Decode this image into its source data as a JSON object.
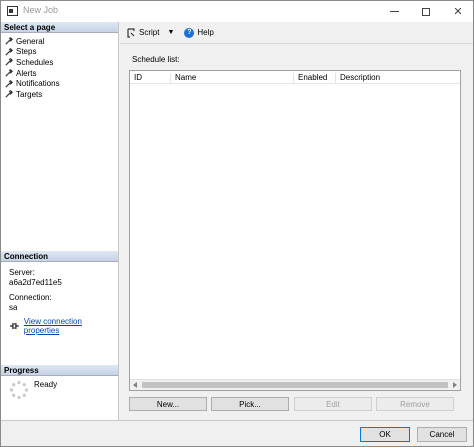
{
  "window": {
    "title": "New Job"
  },
  "left_panel": {
    "select_page_header": "Select a page",
    "pages": [
      "General",
      "Steps",
      "Schedules",
      "Alerts",
      "Notifications",
      "Targets"
    ],
    "connection_header": "Connection",
    "server_label": "Server:",
    "server_value": "a6a2d7ed11e5",
    "connection_label": "Connection:",
    "connection_value": "sa",
    "view_connection_link": "View connection properties",
    "progress_header": "Progress",
    "progress_status": "Ready"
  },
  "toolbar": {
    "script_label": "Script",
    "help_label": "Help"
  },
  "main": {
    "schedule_list_label": "Schedule list:",
    "columns": [
      "ID",
      "Name",
      "Enabled",
      "Description"
    ],
    "buttons": {
      "new": "New...",
      "pick": "Pick...",
      "edit": "Edit",
      "remove": "Remove"
    }
  },
  "footer": {
    "ok": "OK",
    "cancel": "Cancel"
  }
}
